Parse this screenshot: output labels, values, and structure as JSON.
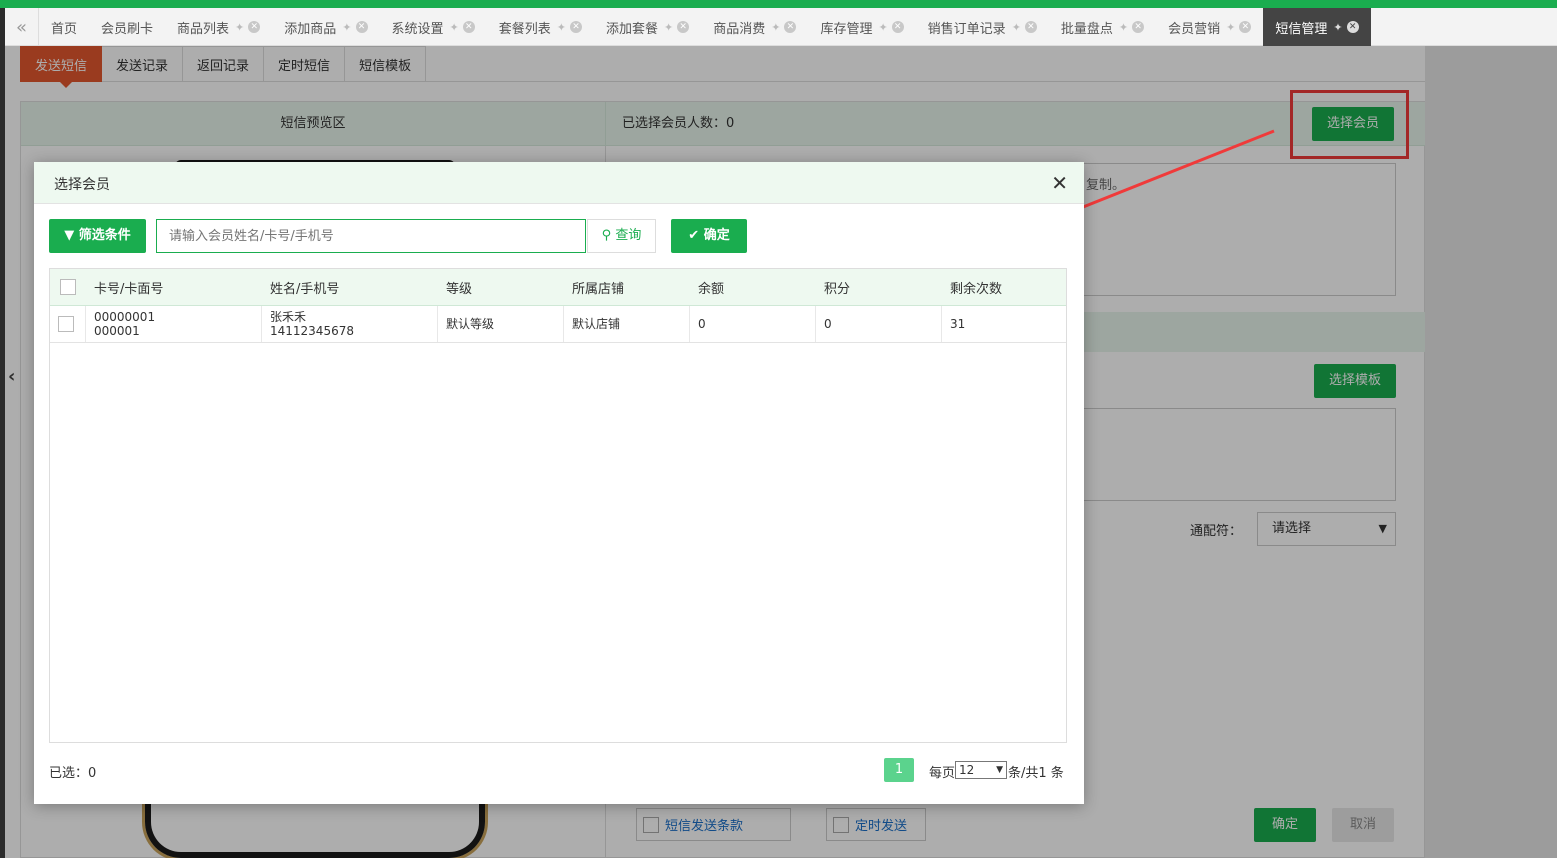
{
  "tabs": [
    {
      "label": "首页"
    },
    {
      "label": "会员刷卡"
    },
    {
      "label": "商品列表"
    },
    {
      "label": "添加商品"
    },
    {
      "label": "系统设置"
    },
    {
      "label": "套餐列表"
    },
    {
      "label": "添加套餐"
    },
    {
      "label": "商品消费"
    },
    {
      "label": "库存管理"
    },
    {
      "label": "销售订单记录"
    },
    {
      "label": "批量盘点"
    },
    {
      "label": "会员营销"
    },
    {
      "label": "短信管理"
    }
  ],
  "active_tab": "短信管理",
  "subtabs": [
    "发送短信",
    "发送记录",
    "返回记录",
    "定时短信",
    "短信模板"
  ],
  "background": {
    "preview_title": "短信预览区",
    "selected_count_label": "已选择会员人数：0",
    "select_member_button": "选择会员",
    "textarea_hint_fragment": "复制。",
    "select_template_button": "选择模板",
    "wildcard_label": "通配符：",
    "wildcard_value": "请选择",
    "terms_label": "短信发送条款",
    "timed_label": "定时发送",
    "confirm_button": "确定",
    "cancel_button": "取消"
  },
  "modal": {
    "title": "选择会员",
    "filter_button": "筛选条件",
    "search_placeholder": "请输入会员姓名/卡号/手机号",
    "query_button": "查询",
    "ok_button": "确定",
    "columns": [
      "卡号/卡面号",
      "姓名/手机号",
      "等级",
      "所属店铺",
      "余额",
      "积分",
      "剩余次数"
    ],
    "rows": [
      {
        "card_no": "00000001",
        "card_face": "000001",
        "name": "张禾禾",
        "phone": "14112345678",
        "level": "默认等级",
        "store": "默认店铺",
        "balance": "0",
        "points": "0",
        "remaining": "31"
      }
    ],
    "selected_label": "已选：0",
    "current_page": "1",
    "per_page_label": "每页",
    "per_page_value": "12",
    "total_label": "条/共1 条"
  },
  "colors": {
    "accent_green": "#1aad4f",
    "active_subtab": "#e4572e",
    "annotation_red": "#f03a3a"
  }
}
